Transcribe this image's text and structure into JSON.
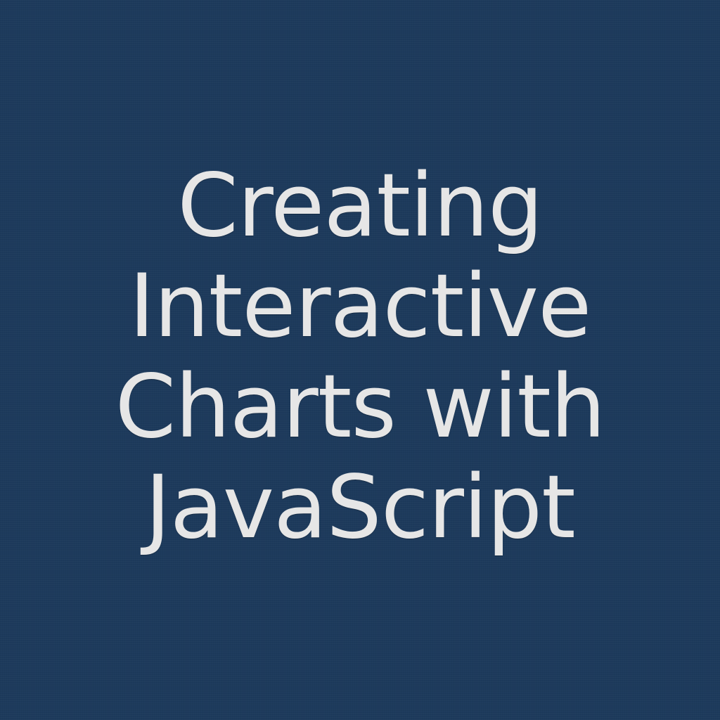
{
  "colors": {
    "background": "#1d3a5c",
    "text": "#e6e6e6"
  },
  "title": {
    "lines": [
      "Creating",
      "Interactive",
      "Charts with",
      "JavaScript"
    ]
  }
}
